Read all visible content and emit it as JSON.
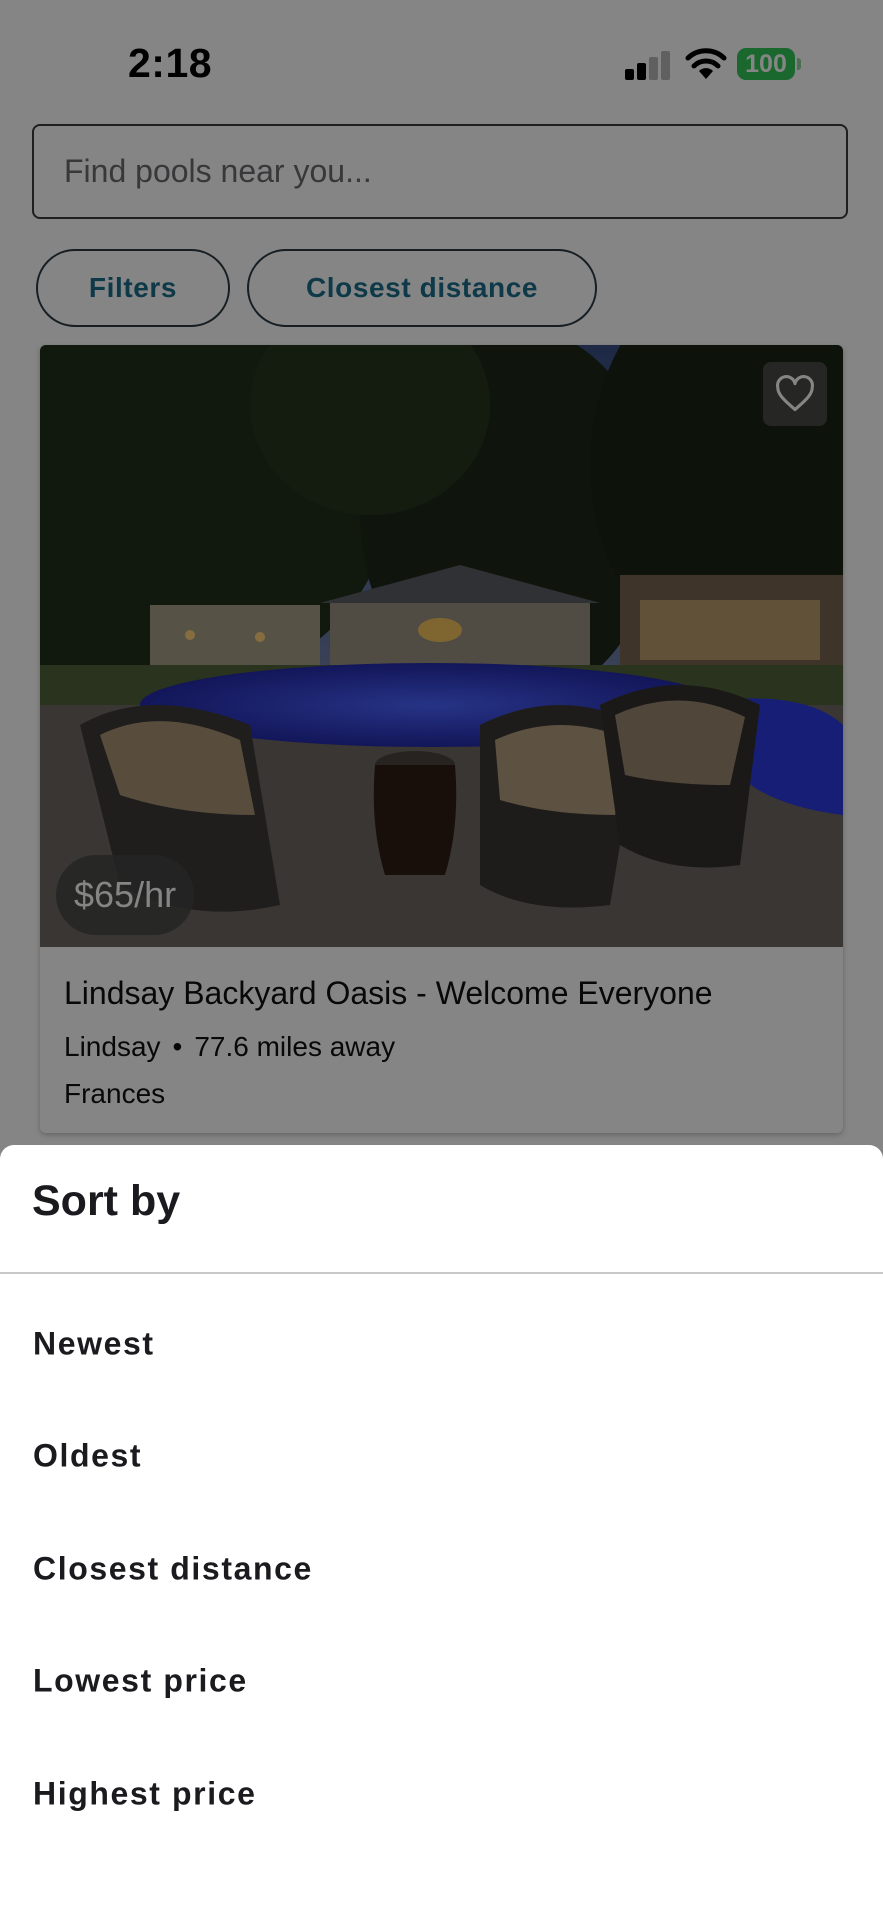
{
  "status_bar": {
    "time": "2:18",
    "battery": "100",
    "signal_icon": "cellular-signal-icon",
    "wifi_icon": "wifi-icon",
    "battery_color": "#34c759"
  },
  "search": {
    "placeholder": "Find pools near you...",
    "value": ""
  },
  "chips": {
    "filters_label": "Filters",
    "sort_label": "Closest distance",
    "accent_color": "#1b6e8c"
  },
  "listing": {
    "price": "$65/hr",
    "title": "Lindsay Backyard Oasis - Welcome Everyone",
    "location": "Lindsay",
    "separator": "•",
    "distance": "77.6 miles away",
    "host": "Frances",
    "favorite_icon": "heart-outline-icon"
  },
  "sort_sheet": {
    "title": "Sort by",
    "options": [
      {
        "label": "Newest"
      },
      {
        "label": "Oldest"
      },
      {
        "label": "Closest distance"
      },
      {
        "label": "Lowest price"
      },
      {
        "label": "Highest price"
      }
    ]
  }
}
